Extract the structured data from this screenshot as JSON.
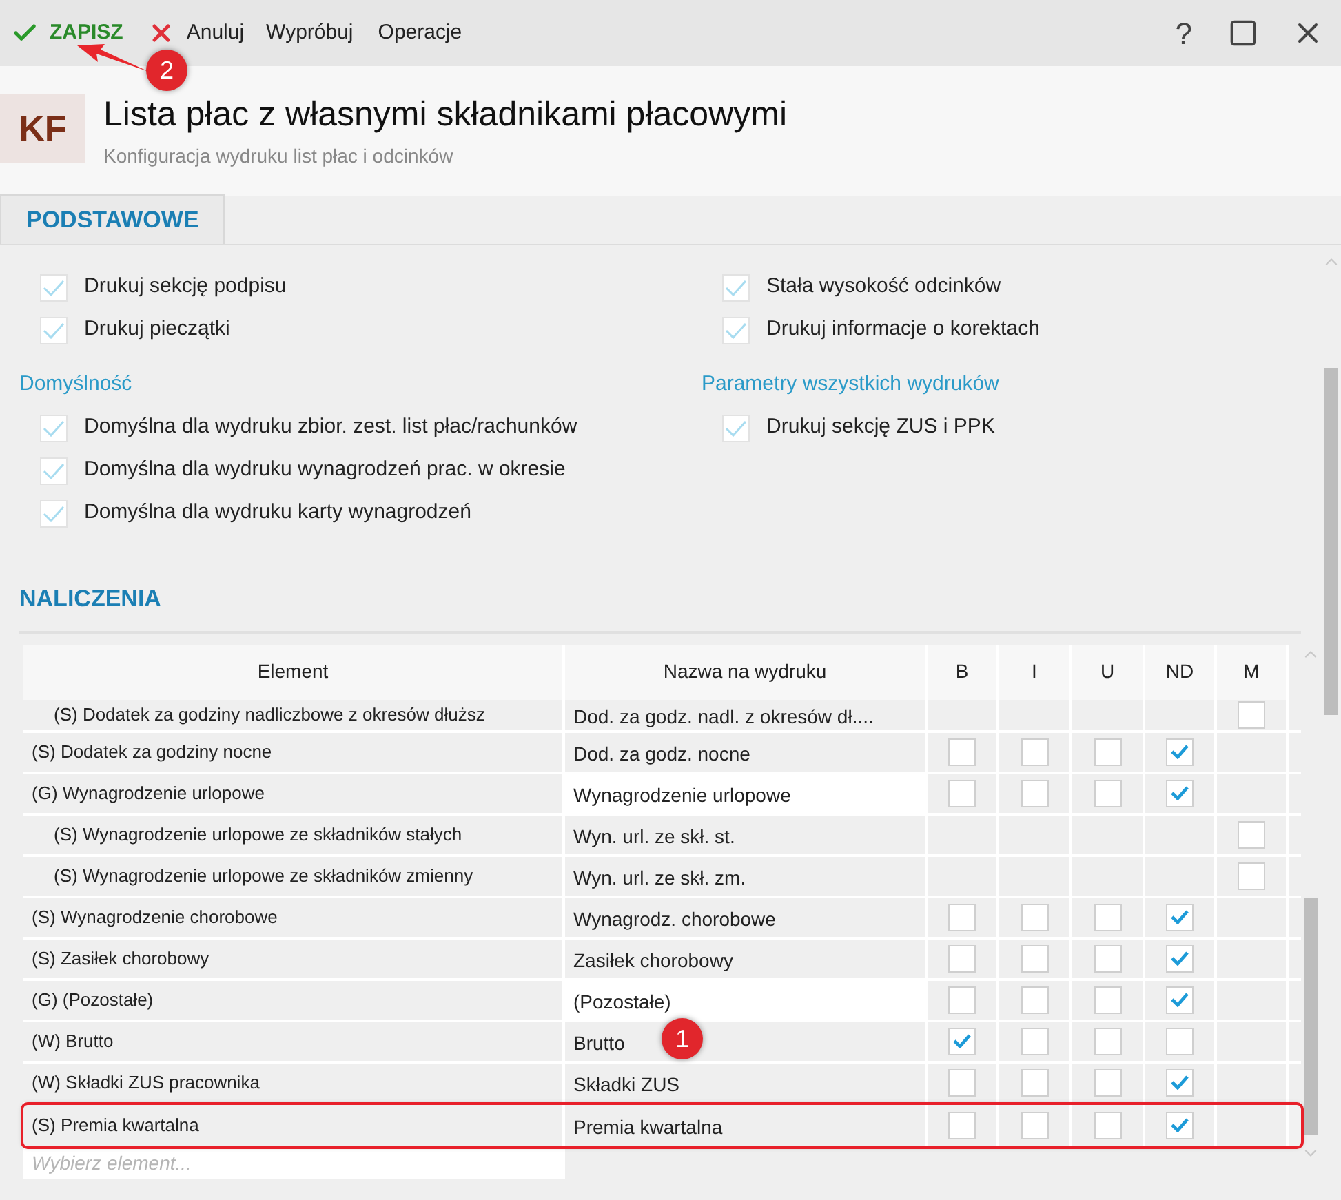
{
  "toolbar": {
    "save": "ZAPISZ",
    "cancel": "Anuluj",
    "try": "Wypróbuj",
    "operations": "Operacje",
    "help": "?"
  },
  "header": {
    "badge": "KF",
    "title": "Lista płac z własnymi składnikami płacowymi",
    "subtitle": "Konfiguracja wydruku list płac i odcinków"
  },
  "tabs": [
    {
      "label": "PODSTAWOWE",
      "selected": true
    }
  ],
  "print_options": {
    "left": [
      {
        "label": "Drukuj sekcję podpisu",
        "checked": true
      },
      {
        "label": "Drukuj pieczątki",
        "checked": true
      }
    ],
    "right": [
      {
        "label": "Stała wysokość odcinków",
        "checked": true
      },
      {
        "label": "Drukuj informacje o korektach",
        "checked": true
      }
    ]
  },
  "groups": [
    {
      "title": "Domyślność",
      "options": [
        {
          "label": "Domyślna dla wydruku zbior. zest. list płac/rachunków",
          "checked": true
        },
        {
          "label": "Domyślna dla wydruku wynagrodzeń prac. w okresie",
          "checked": true
        },
        {
          "label": "Domyślna dla wydruku karty wynagrodzeń",
          "checked": true
        }
      ]
    },
    {
      "title": "Parametry wszystkich wydruków",
      "options": [
        {
          "label": "Drukuj sekcję ZUS i PPK",
          "checked": true
        }
      ]
    }
  ],
  "section_title": "NALICZENIA",
  "table": {
    "columns": [
      "Element",
      "Nazwa na wydruku",
      "B",
      "I",
      "U",
      "ND",
      "M"
    ],
    "rows": [
      {
        "element": "(S) Dodatek za godziny nadliczbowe z okresów dłuższ",
        "print_name": "Dod. za godz. nadl. z okresów dł....",
        "nested": true,
        "white": false,
        "selected": false,
        "checks": {
          "m": false
        }
      },
      {
        "element": "(S) Dodatek za godziny nocne",
        "print_name": "Dod. za godz. nocne",
        "nested": false,
        "white": false,
        "selected": false,
        "checks": {
          "b": false,
          "i": false,
          "u": false,
          "nd": true
        }
      },
      {
        "element": "(G) Wynagrodzenie urlopowe",
        "print_name": "Wynagrodzenie urlopowe",
        "nested": false,
        "white": true,
        "selected": false,
        "checks": {
          "b": false,
          "i": false,
          "u": false,
          "nd": true
        }
      },
      {
        "element": "(S) Wynagrodzenie urlopowe ze składników stałych",
        "print_name": "Wyn. url. ze skł. st.",
        "nested": true,
        "white": false,
        "selected": false,
        "checks": {
          "m": false
        }
      },
      {
        "element": "(S) Wynagrodzenie urlopowe ze składników zmienny",
        "print_name": "Wyn. url. ze skł. zm.",
        "nested": true,
        "white": false,
        "selected": false,
        "checks": {
          "m": false
        }
      },
      {
        "element": "(S) Wynagrodzenie chorobowe",
        "print_name": "Wynagrodz. chorobowe",
        "nested": false,
        "white": false,
        "selected": false,
        "checks": {
          "b": false,
          "i": false,
          "u": false,
          "nd": true
        }
      },
      {
        "element": "(S) Zasiłek chorobowy",
        "print_name": "Zasiłek chorobowy",
        "nested": false,
        "white": false,
        "selected": false,
        "checks": {
          "b": false,
          "i": false,
          "u": false,
          "nd": true
        }
      },
      {
        "element": "(G) (Pozostałe)",
        "print_name": "(Pozostałe)",
        "nested": false,
        "white": true,
        "selected": false,
        "checks": {
          "b": false,
          "i": false,
          "u": false,
          "nd": true
        }
      },
      {
        "element": "(W) Brutto",
        "print_name": "Brutto",
        "nested": false,
        "white": false,
        "selected": false,
        "checks": {
          "b": true,
          "i": false,
          "u": false,
          "nd": false
        }
      },
      {
        "element": "(W) Składki ZUS pracownika",
        "print_name": "Składki ZUS",
        "nested": false,
        "white": false,
        "selected": false,
        "checks": {
          "b": false,
          "i": false,
          "u": false,
          "nd": true
        }
      },
      {
        "element": "(S) Premia kwartalna",
        "print_name": "Premia kwartalna",
        "nested": false,
        "white": false,
        "selected": true,
        "checks": {
          "b": false,
          "i": false,
          "u": false,
          "nd": true
        }
      }
    ],
    "new_row": {
      "placeholder": "Wybierz element..."
    }
  },
  "annotations": [
    {
      "label": "2"
    },
    {
      "label": "1"
    }
  ]
}
